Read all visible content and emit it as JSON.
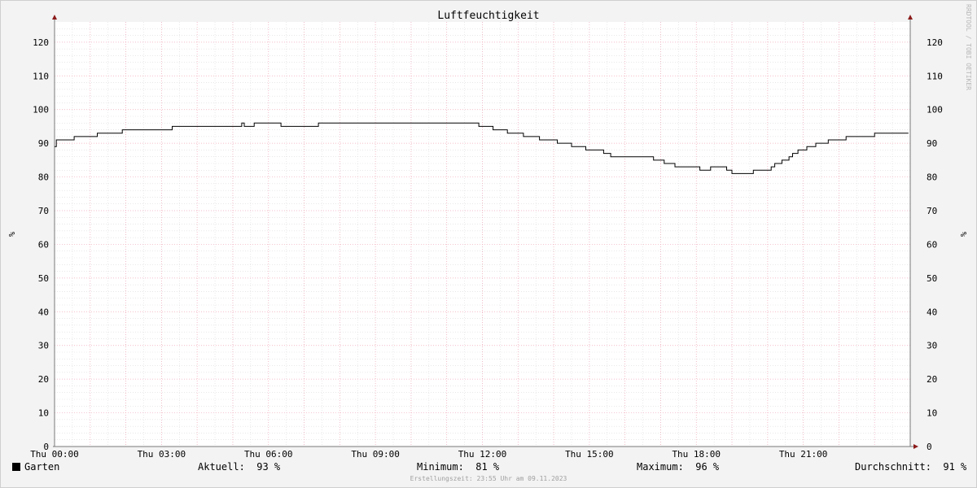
{
  "chart_data": {
    "type": "line",
    "title": "Luftfeuchtigkeit",
    "ylabel": "%",
    "ylim": [
      0,
      126
    ],
    "yticks": [
      0,
      10,
      20,
      30,
      40,
      50,
      60,
      70,
      80,
      90,
      100,
      110,
      120
    ],
    "xlim": [
      0,
      24
    ],
    "xticks": [
      {
        "h": 0,
        "label": "Thu 00:00"
      },
      {
        "h": 3,
        "label": "Thu 03:00"
      },
      {
        "h": 6,
        "label": "Thu 06:00"
      },
      {
        "h": 9,
        "label": "Thu 09:00"
      },
      {
        "h": 12,
        "label": "Thu 12:00"
      },
      {
        "h": 15,
        "label": "Thu 15:00"
      },
      {
        "h": 18,
        "label": "Thu 18:00"
      },
      {
        "h": 21,
        "label": "Thu 21:00"
      }
    ],
    "grid": true,
    "watermark": "RRDTOOL / TOBI OETIKER",
    "series": [
      {
        "name": "Garten",
        "color": "#000000",
        "x": [
          0,
          0.05,
          0.55,
          1.2,
          1.9,
          3.3,
          5.25,
          5.32,
          5.6,
          6.35,
          7.4,
          11.9,
          12.3,
          12.7,
          13.15,
          13.6,
          14.1,
          14.5,
          14.9,
          15.4,
          15.6,
          16.8,
          17.1,
          17.4,
          18.1,
          18.4,
          18.85,
          19.0,
          19.6,
          20.1,
          20.2,
          20.4,
          20.6,
          20.7,
          20.85,
          21.1,
          21.35,
          21.7,
          22.2,
          23.0,
          23.95
        ],
        "y": [
          89,
          91,
          92,
          93,
          94,
          95,
          96,
          95,
          96,
          95,
          96,
          95,
          94,
          93,
          92,
          91,
          90,
          89,
          88,
          87,
          86,
          85,
          84,
          83,
          82,
          83,
          82,
          81,
          82,
          83,
          84,
          85,
          86,
          87,
          88,
          89,
          90,
          91,
          92,
          93,
          93
        ]
      }
    ]
  },
  "legend": {
    "name": "Garten",
    "current_label": "Aktuell:",
    "current_value": "93 %",
    "min_label": "Minimum:",
    "min_value": "81 %",
    "max_label": "Maximum:",
    "max_value": "96 %",
    "avg_label": "Durchschnitt:",
    "avg_value": "91 %"
  },
  "footer": "Erstellungszeit: 23:55 Uhr am 09.11.2023"
}
